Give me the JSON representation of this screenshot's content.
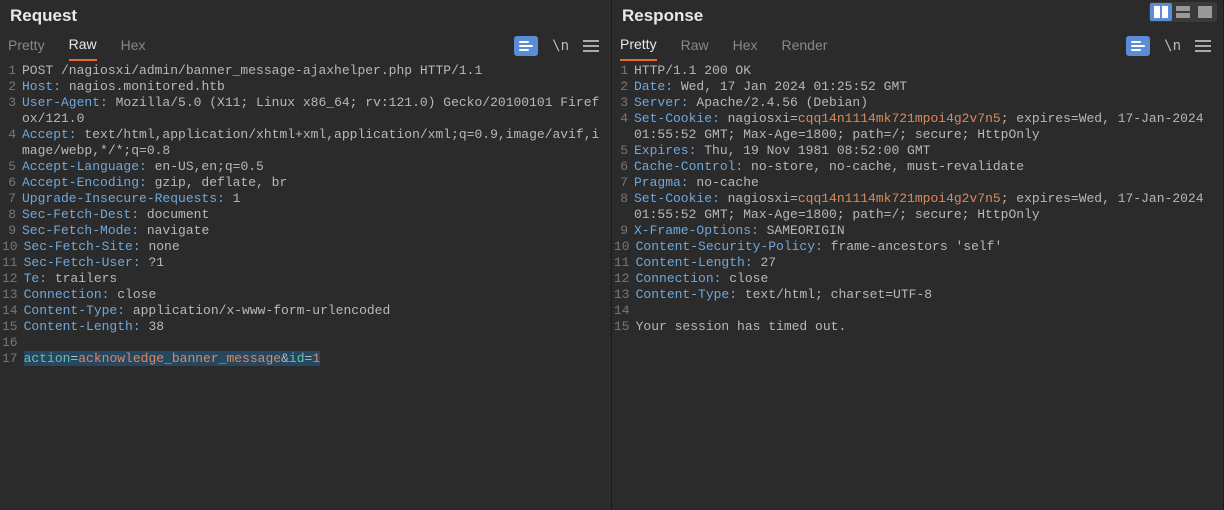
{
  "request": {
    "title": "Request",
    "tabs": {
      "pretty": "Pretty",
      "raw": "Raw",
      "hex": "Hex"
    },
    "activeTab": "Raw",
    "lines": [
      {
        "n": 1,
        "parts": [
          {
            "t": "POST /nagiosxi/admin/banner_message-ajaxhelper.php HTTP/1.1"
          }
        ]
      },
      {
        "n": 2,
        "parts": [
          {
            "t": "Host:",
            "c": "hdr"
          },
          {
            "t": " nagios.monitored.htb"
          }
        ]
      },
      {
        "n": 3,
        "parts": [
          {
            "t": "User-Agent:",
            "c": "hdr"
          },
          {
            "t": " Mozilla/5.0 (X11; Linux x86_64; rv:121.0) Gecko/20100101 Firefox/121.0"
          }
        ]
      },
      {
        "n": 4,
        "parts": [
          {
            "t": "Accept:",
            "c": "hdr"
          },
          {
            "t": " text/html,application/xhtml+xml,application/xml;q=0.9,image/avif,image/webp,*/*;q=0.8"
          }
        ]
      },
      {
        "n": 5,
        "parts": [
          {
            "t": "Accept-Language:",
            "c": "hdr"
          },
          {
            "t": " en-US,en;q=0.5"
          }
        ]
      },
      {
        "n": 6,
        "parts": [
          {
            "t": "Accept-Encoding:",
            "c": "hdr"
          },
          {
            "t": " gzip, deflate, br"
          }
        ]
      },
      {
        "n": 7,
        "parts": [
          {
            "t": "Upgrade-Insecure-Requests:",
            "c": "hdr"
          },
          {
            "t": " 1"
          }
        ]
      },
      {
        "n": 8,
        "parts": [
          {
            "t": "Sec-Fetch-Dest:",
            "c": "hdr"
          },
          {
            "t": " document"
          }
        ]
      },
      {
        "n": 9,
        "parts": [
          {
            "t": "Sec-Fetch-Mode:",
            "c": "hdr"
          },
          {
            "t": " navigate"
          }
        ]
      },
      {
        "n": 10,
        "parts": [
          {
            "t": "Sec-Fetch-Site:",
            "c": "hdr"
          },
          {
            "t": " none"
          }
        ]
      },
      {
        "n": 11,
        "parts": [
          {
            "t": "Sec-Fetch-User:",
            "c": "hdr"
          },
          {
            "t": " ?1"
          }
        ]
      },
      {
        "n": 12,
        "parts": [
          {
            "t": "Te:",
            "c": "hdr"
          },
          {
            "t": " trailers"
          }
        ]
      },
      {
        "n": 13,
        "parts": [
          {
            "t": "Connection:",
            "c": "hdr"
          },
          {
            "t": " close"
          }
        ]
      },
      {
        "n": 14,
        "parts": [
          {
            "t": "Content-Type:",
            "c": "hdr"
          },
          {
            "t": " application/x-www-form-urlencoded"
          }
        ]
      },
      {
        "n": 15,
        "parts": [
          {
            "t": "Content-Length:",
            "c": "hdr"
          },
          {
            "t": " 38"
          }
        ]
      },
      {
        "n": 16,
        "parts": [
          {
            "t": ""
          }
        ]
      },
      {
        "n": 17,
        "parts": [
          {
            "t": "action",
            "c": "sel pname"
          },
          {
            "t": "=",
            "c": "sel"
          },
          {
            "t": "acknowledge_banner_message",
            "c": "sel-orange"
          },
          {
            "t": "&",
            "c": "sel"
          },
          {
            "t": "id",
            "c": "sel pname"
          },
          {
            "t": "=",
            "c": "sel"
          },
          {
            "t": "1",
            "c": "sel-orange"
          }
        ]
      }
    ]
  },
  "response": {
    "title": "Response",
    "tabs": {
      "pretty": "Pretty",
      "raw": "Raw",
      "hex": "Hex",
      "render": "Render"
    },
    "activeTab": "Pretty",
    "lines": [
      {
        "n": 1,
        "parts": [
          {
            "t": "HTTP/1.1 200 OK"
          }
        ]
      },
      {
        "n": 2,
        "parts": [
          {
            "t": "Date:",
            "c": "hdr"
          },
          {
            "t": " Wed, 17 Jan 2024 01:25:52 GMT"
          }
        ]
      },
      {
        "n": 3,
        "parts": [
          {
            "t": "Server:",
            "c": "hdr"
          },
          {
            "t": " Apache/2.4.56 (Debian)"
          }
        ]
      },
      {
        "n": 4,
        "parts": [
          {
            "t": "Set-Cookie:",
            "c": "hdr"
          },
          {
            "t": " nagiosxi="
          },
          {
            "t": "cqq14n1114mk721mpoi4g2v7n5",
            "c": "pval"
          },
          {
            "t": "; expires=Wed, 17-Jan-2024 01:55:52 GMT; Max-Age=1800; path=/; secure; HttpOnly"
          }
        ]
      },
      {
        "n": 5,
        "parts": [
          {
            "t": "Expires:",
            "c": "hdr"
          },
          {
            "t": " Thu, 19 Nov 1981 08:52:00 GMT"
          }
        ]
      },
      {
        "n": 6,
        "parts": [
          {
            "t": "Cache-Control:",
            "c": "hdr"
          },
          {
            "t": " no-store, no-cache, must-revalidate"
          }
        ]
      },
      {
        "n": 7,
        "parts": [
          {
            "t": "Pragma:",
            "c": "hdr"
          },
          {
            "t": " no-cache"
          }
        ]
      },
      {
        "n": 8,
        "parts": [
          {
            "t": "Set-Cookie:",
            "c": "hdr"
          },
          {
            "t": " nagiosxi="
          },
          {
            "t": "cqq14n1114mk721mpoi4g2v7n5",
            "c": "pval"
          },
          {
            "t": "; expires=Wed, 17-Jan-2024 01:55:52 GMT; Max-Age=1800; path=/; secure; HttpOnly"
          }
        ]
      },
      {
        "n": 9,
        "parts": [
          {
            "t": "X-Frame-Options:",
            "c": "hdr"
          },
          {
            "t": " SAMEORIGIN"
          }
        ]
      },
      {
        "n": 10,
        "parts": [
          {
            "t": "Content-Security-Policy:",
            "c": "hdr"
          },
          {
            "t": " frame-ancestors 'self'"
          }
        ]
      },
      {
        "n": 11,
        "parts": [
          {
            "t": "Content-Length:",
            "c": "hdr"
          },
          {
            "t": " 27"
          }
        ]
      },
      {
        "n": 12,
        "parts": [
          {
            "t": "Connection:",
            "c": "hdr"
          },
          {
            "t": " close"
          }
        ]
      },
      {
        "n": 13,
        "parts": [
          {
            "t": "Content-Type:",
            "c": "hdr"
          },
          {
            "t": " text/html; charset=UTF-8"
          }
        ]
      },
      {
        "n": 14,
        "parts": [
          {
            "t": ""
          }
        ]
      },
      {
        "n": 15,
        "parts": [
          {
            "t": "Your session has timed out."
          }
        ]
      }
    ]
  },
  "icons": {
    "newline": "\\n"
  }
}
